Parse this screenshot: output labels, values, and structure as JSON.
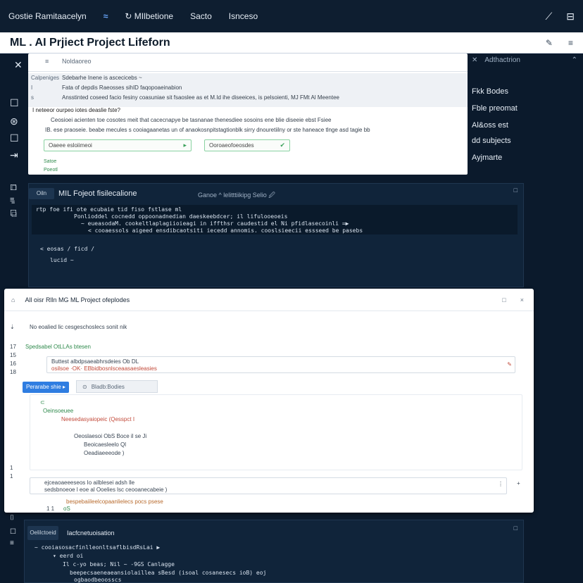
{
  "topbar": {
    "nav": [
      "Gostie Ramitaacelyn",
      "≈",
      "↻ MIlbetione",
      "Sacto",
      "Isnceso"
    ],
    "right_icons": [
      "cursor-icon",
      "panel-icon"
    ]
  },
  "titlebar": {
    "title": "ML . AI Prjiect Project Lifeforn",
    "tools": [
      "✎",
      "≡"
    ]
  },
  "leftrail": {
    "icons": [
      "✕",
      "☐",
      "⊛",
      "☐",
      "⇥",
      "☐",
      "≡",
      "☐",
      "⌷",
      "☐",
      "≡"
    ]
  },
  "rightrail": {
    "header_label": "Adthactrion",
    "header_close": "⌃",
    "items": [
      "Fkk Bodes",
      "Fble preomat",
      "Al&oss est",
      "dd subjects",
      "Ayjmarte"
    ]
  },
  "panel1": {
    "head_label": "Noldaoreo",
    "table": [
      {
        "k": "Calpeniges",
        "v": "Sdebarhe Inene is ascecicebs  ~"
      },
      {
        "k": "I",
        "v": "Fata of depdis Raeosses sihID faqopoaeinabion"
      },
      {
        "k": "s",
        "v": "Ansstinted coseed facio fesiny coasuniae sit fsaoslee as et M.Id ihe diseeices, is pelsoienti, MJ FMt Al Meentee"
      }
    ],
    "question": "I neteeor ourpeo iotes deaslie fste?",
    "lines": [
      "Ceosioei acienten toe cosotes meit that cacecnapye be tasnanae thenesdiee sosoins ene blie diseeie ebst Fsiee",
      "IB. ese praoseie. beabe mecules s  cooiagaanetas un of anaokosnpitstagtionblk sirry dnouretiilny or ste haneace tlnge asd tagie bb"
    ],
    "input1": "Oaeee esloiimeoi",
    "input2": "Ooroaeofoeosdes",
    "small1": "Satoe",
    "small2": "Poeotl"
  },
  "panel2": {
    "tab": "Oiln",
    "title": "MIL Fojeot fisilecalione",
    "subtitle": "Ganoe ^ lelitttiikipg  Selio 🖉",
    "max": "□",
    "code": [
      "rtp foe  ifi ote  ecubaie  tid fiso  fstlase  ml",
      "Ponlioddel  cocnedd  oppoonadnedian  daeskeebdcer;  il  lifulooeoeis",
      "~  eueasodaM.  cookeltlaplagiioieagi  in  iffthsr  caudestid  el  Ni  pfidlasecoinli  =▶",
      "<  cooaessols  aigeed ensdibcaotsiti  iecedd  annomis.  cooslsieecii  essseed  be  pasebs"
    ],
    "extra": [
      "<  eosas /  ficd  /",
      "lucid  ~"
    ]
  },
  "panel3": {
    "title": "All oisr Rlln MG  ML  Project ofeplodes",
    "max": [
      "□",
      "×"
    ],
    "note": "No eoalied lic cesgeschoslecs  sonit  nik",
    "green1": "Spedsabel  OtLLAs  btesen",
    "line_a": "Buttest  albdpsaeabhrsdeies  Ob  DL",
    "line_b": "osilsoe  ·OK· EBbidbosnlsceaasaesleasies",
    "button": "Perarabe shie  ▸",
    "chip": "Bladb:Bodies",
    "green2": "Oeinsoeuee",
    "red1": "Neesedasyaiopeic  (Qesspct  I",
    "line_c": "Oeoslaesoi  ObS  Boce  il  se  Ji",
    "line_d": "Beoicaesleelo  Ql",
    "line_e": "Oeadiaeeeode  )",
    "line_f": "ejceaoaeeeseos  Io ailblesei  adsh  lle",
    "line_g": "sedsbnoeoe  l  eoe  al  Ooelies  lsc  ceooanecabeie  )",
    "red2": "bespebaiileelcopaanlielecs  pocs  psese",
    "red_small": "oS",
    "num": "1 1",
    "plus": "+"
  },
  "panel4": {
    "tab": "Oelilctoeid",
    "title": "Iacfcnetuoisation",
    "max": "□",
    "code": [
      "~ cooiasosacfinlleonltsaflbisdRsLai ▶",
      "▾ eerd oi",
      "Il  c-yo  beas;  Nil  ~ -9GS Canlagge",
      "beepecsaeneaeansiolaillea sBesd (isoal cosanesecs  ioB) eoj",
      "ogbaodbeoosscs"
    ]
  }
}
